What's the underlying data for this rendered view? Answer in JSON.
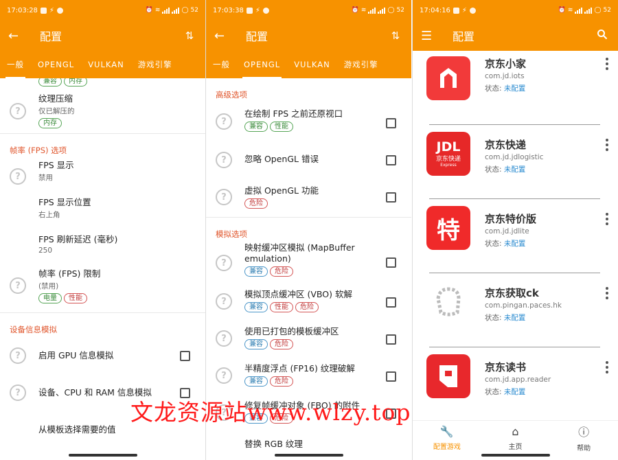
{
  "panels": {
    "p1": {
      "statusbar": {
        "time": "17:03:28",
        "battery": "52"
      },
      "appbar": {
        "title": "配置",
        "back_icon": "arrow-left",
        "sort_icon": "sort-arrows"
      },
      "tabs": [
        "一般",
        "OPENGL",
        "VULKAN",
        "游戏引擎"
      ],
      "top_chips": [
        "兼容",
        "内存"
      ],
      "items": [
        {
          "title": "纹理压缩",
          "sub": "仅已解压的",
          "chips": [
            "内存"
          ]
        }
      ],
      "section_fps": "帧率 (FPS) 选项",
      "fps_items": [
        {
          "title": "FPS 显示",
          "sub": "禁用"
        },
        {
          "title": "FPS 显示位置",
          "sub": "右上角"
        },
        {
          "title": "FPS 刷新延迟 (毫秒)",
          "sub": "250"
        },
        {
          "title": "帧率 (FPS) 限制",
          "sub": "(禁用)",
          "chips": [
            "电量",
            "性能"
          ]
        }
      ],
      "section_device": "设备信息模拟",
      "device_items": [
        {
          "title": "启用 GPU 信息模拟"
        },
        {
          "title": "设备、CPU 和 RAM 信息模拟"
        },
        {
          "title": "从模板选择需要的值"
        }
      ]
    },
    "p2": {
      "statusbar": {
        "time": "17:03:38",
        "battery": "52"
      },
      "appbar": {
        "title": "配置"
      },
      "tabs": [
        "一般",
        "OPENGL",
        "VULKAN",
        "游戏引擎"
      ],
      "section_advanced": "高级选项",
      "advanced_items": [
        {
          "title": "在绘制 FPS 之前还原视口",
          "chips": [
            "兼容",
            "性能"
          ]
        },
        {
          "title": "忽略 OpenGL 错误"
        },
        {
          "title": "虚拟 OpenGL 功能",
          "chips": [
            "危险"
          ]
        }
      ],
      "section_emulation": "模拟选项",
      "emulation_items": [
        {
          "title": "映射缓冲区模拟 (MapBuffer emulation)",
          "chips": [
            "兼容",
            "危险"
          ]
        },
        {
          "title": "模拟顶点缓冲区 (VBO) 软解",
          "chips": [
            "兼容",
            "性能",
            "危险"
          ]
        },
        {
          "title": "使用已打包的模板缓冲区",
          "chips": [
            "兼容",
            "危险"
          ]
        },
        {
          "title": "半精度浮点 (FP16) 纹理破解",
          "chips": [
            "兼容",
            "危险"
          ]
        },
        {
          "title": "修复帧缓冲对象 (FBO) 的附件",
          "chips": [
            "兼容",
            "危险"
          ]
        },
        {
          "title": "替换 RGB 纹理"
        }
      ]
    },
    "p3": {
      "statusbar": {
        "time": "17:04:16",
        "battery": "52"
      },
      "appbar": {
        "title": "配置",
        "menu_icon": "hamburger",
        "search_icon": "search"
      },
      "apps": [
        {
          "name": "京东小家",
          "pkg": "com.jd.iots",
          "status_label": "状态: ",
          "status_value": "未配置"
        },
        {
          "name": "京东快递",
          "pkg": "com.jd.jdlogistic",
          "status_label": "状态: ",
          "status_value": "未配置",
          "icon_text": "JDL",
          "icon_sub": "京东快递",
          "icon_sub2": "Express"
        },
        {
          "name": "京东特价版",
          "pkg": "com.jd.jdlite",
          "status_label": "状态: ",
          "status_value": "未配置",
          "icon_text": "特"
        },
        {
          "name": "京东获取ck",
          "pkg": "com.pingan.paces.hk",
          "status_label": "状态: ",
          "status_value": "未配置"
        },
        {
          "name": "京东读书",
          "pkg": "com.jd.app.reader",
          "status_label": "状态: ",
          "status_value": "未配置"
        }
      ],
      "bottom_nav": [
        {
          "label": "配置游戏",
          "icon": "wrench",
          "active": true
        },
        {
          "label": "主页",
          "icon": "home"
        },
        {
          "label": "帮助",
          "icon": "help"
        }
      ]
    }
  },
  "watermark": "文龙资源站www.wlzy.top",
  "colors": {
    "accent": "#f79200",
    "section": "#e0552b",
    "status_link": "#2a8bd0"
  }
}
